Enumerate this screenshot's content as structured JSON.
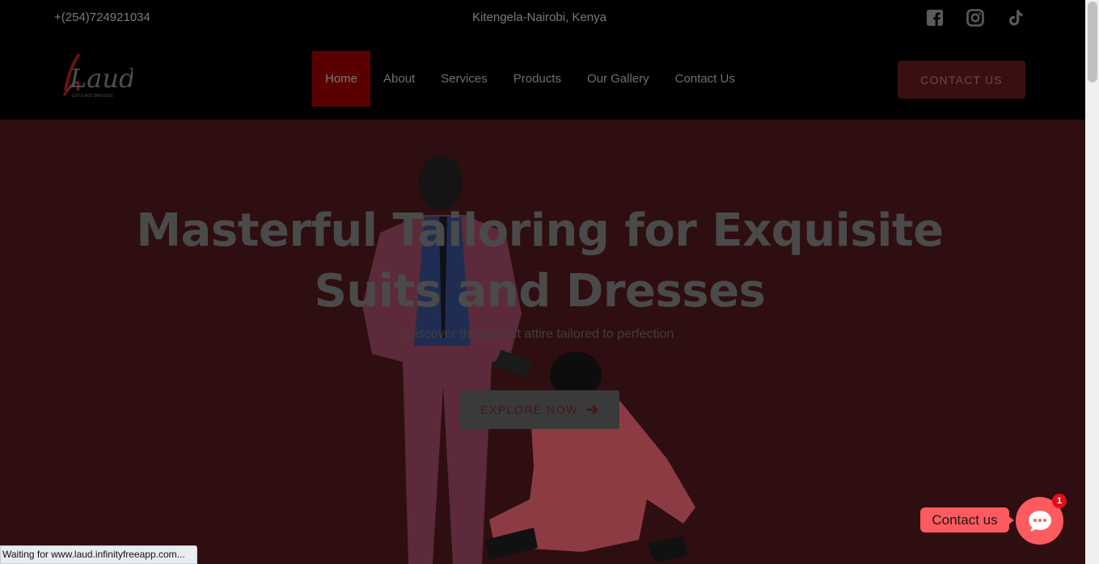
{
  "topbar": {
    "phone": "+(254)724921034",
    "location": "Kitengela-Nairobi, Kenya",
    "social_icons": [
      "facebook-icon",
      "instagram-icon",
      "tiktok-icon"
    ]
  },
  "header": {
    "logo_text": "Laud",
    "logo_tagline": "SUITS AND DRESSES",
    "nav": [
      {
        "label": "Home",
        "active": true
      },
      {
        "label": "About",
        "active": false
      },
      {
        "label": "Services",
        "active": false
      },
      {
        "label": "Products",
        "active": false
      },
      {
        "label": "Our Gallery",
        "active": false
      },
      {
        "label": "Contact Us",
        "active": false
      }
    ],
    "cta_label": "CONTACT US"
  },
  "hero": {
    "title": "Masterful Tailoring for Exquisite Suits and Dresses",
    "subtitle": "Discover the perfect attire tailored to perfection",
    "button_label": "EXPLORE NOW",
    "button_icon": "arrow-right-icon"
  },
  "chat": {
    "label": "Contact us",
    "badge_count": "1",
    "icon": "chat-bubble-icon"
  },
  "status_bar": {
    "text": "Waiting for www.laud.infinityfreeapp.com..."
  },
  "colors": {
    "hero_overlay": "#2e0e10",
    "nav_active": "#5a0000",
    "chat_accent": "#ff5a5f",
    "badge": "#e0101a"
  }
}
